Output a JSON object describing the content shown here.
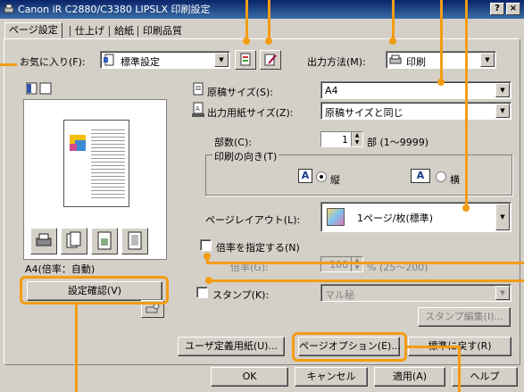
{
  "window": {
    "title": "Canon iR C2880/C3380 LIPSLX 印刷設定",
    "help_btn": "?",
    "close_btn": "×"
  },
  "tabs": [
    "ページ設定",
    "仕上げ",
    "給紙",
    "印刷品質"
  ],
  "favorites": {
    "label": "お気に入り(F):",
    "value": "標準設定"
  },
  "output_method": {
    "label": "出力方法(M):",
    "value": "印刷"
  },
  "original_size": {
    "label": "原稿サイズ(S):",
    "value": "A4"
  },
  "output_paper_size": {
    "label": "出力用紙サイズ(Z):",
    "value": "原稿サイズと同じ"
  },
  "copies": {
    "label": "部数(C):",
    "value": "1",
    "unit": "部 (1〜9999)"
  },
  "orientation": {
    "label": "印刷の向き(T)",
    "portrait": "縦",
    "landscape": "横",
    "portrait_glyph": "A",
    "landscape_glyph": "A"
  },
  "page_layout": {
    "label": "ページレイアウト(L):",
    "value": "1ページ/枚(標準)"
  },
  "scaling": {
    "label": "倍率を指定する(N)",
    "sub_label": "倍率(G):",
    "value": "100",
    "range": "% (25〜200)"
  },
  "stamp": {
    "label": "スタンプ(K):",
    "value": "マル秘",
    "edit_button": "スタンプ編集(I)..."
  },
  "preview": {
    "caption": "A4(倍率：自動)",
    "settings_button": "設定確認(V)"
  },
  "buttons": {
    "user_paper": "ユーザ定義用紙(U)...",
    "page_options": "ページオプション(E)...",
    "restore_defaults": "標準に戻す(R)",
    "ok": "OK",
    "cancel": "キャンセル",
    "apply": "適用(A)",
    "help": "ヘルプ"
  },
  "colors": {
    "callout": "#f39c12",
    "titlebar": "#0a246a",
    "dialog": "#d4d0c8"
  }
}
